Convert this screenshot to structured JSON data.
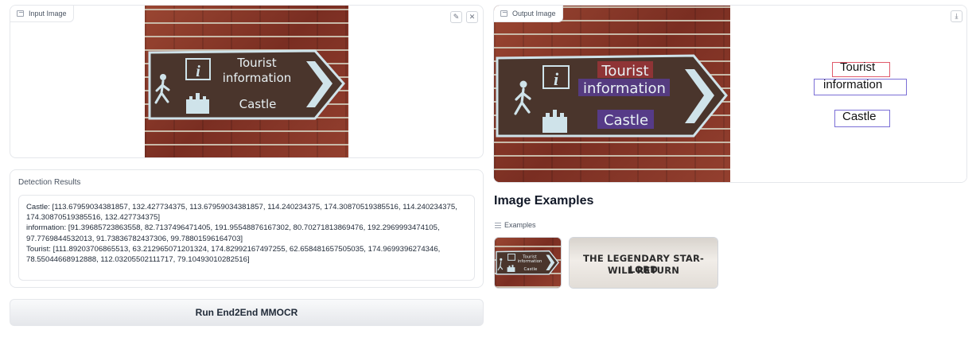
{
  "input_panel": {
    "label": "Input Image",
    "edit_icon": "pencil-icon",
    "clear_icon": "close-icon"
  },
  "sign": {
    "line1": "Tourist",
    "line2": "information",
    "line3": "Castle",
    "info_glyph": "i"
  },
  "results": {
    "label": "Detection Results",
    "text": "Castle: [113.67959034381857, 132.427734375, 113.67959034381857, 114.240234375, 174.30870519385516, 114.240234375, 174.30870519385516, 132.427734375]\ninformation: [91.39685723863558, 82.7137496471405, 191.95548876167302, 80.70271813869476, 192.2969993474105, 97.7769844532013, 91.73836782437306, 99.78801596164703]\nTourist: [111.89203706865513, 63.212965071201324, 174.82992167497255, 62.658481657505035, 174.9699396274346, 78.55044668912888, 112.03205502111717, 79.10493010282516]"
  },
  "run_button": {
    "label": "Run End2End MMOCR"
  },
  "output_panel": {
    "label": "Output Image",
    "download_icon": "download-icon",
    "detections": [
      {
        "text": "Tourist",
        "color": "#e05a6b"
      },
      {
        "text": "information",
        "color": "#7b6fd6"
      },
      {
        "text": "Castle",
        "color": "#7b6fd6"
      }
    ]
  },
  "examples": {
    "title": "Image Examples",
    "label": "Examples",
    "items": [
      {
        "name": "tourist-sign-example",
        "lines": [
          "Tourist",
          "information",
          "Castle"
        ]
      },
      {
        "name": "star-lord-example",
        "lines": [
          "THE LEGENDARY STAR-LORD",
          "WILL RETURN"
        ]
      }
    ]
  },
  "colors": {
    "accent_red": "#e05a6b",
    "accent_purple": "#7b6fd6",
    "sign_brown": "#4a352c",
    "sign_border": "#cfe3ea"
  }
}
